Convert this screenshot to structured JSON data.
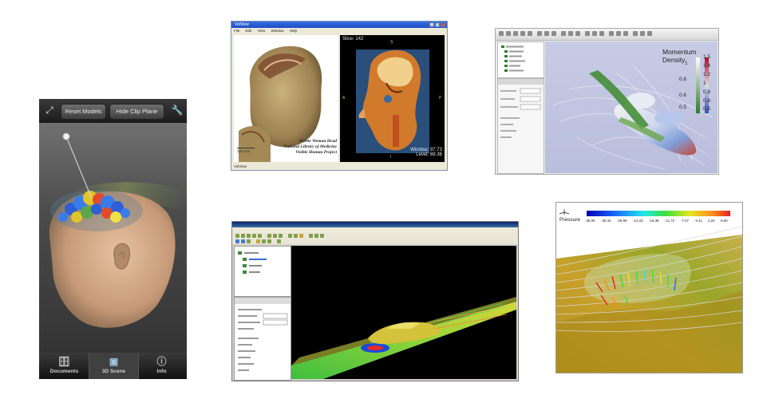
{
  "mobile_app": {
    "toolbar": {
      "reset_label": "Reset Models",
      "clip_label": "Hide Clip Plane"
    },
    "tabs": [
      {
        "label": "Documents",
        "icon": "documents-icon"
      },
      {
        "label": "3D Scene",
        "icon": "scene-icon",
        "selected": true
      },
      {
        "label": "Info",
        "icon": "info-icon"
      }
    ]
  },
  "volume_viewer": {
    "titlebar_text": "VolView",
    "menu": [
      "File",
      "Edit",
      "View",
      "Window",
      "Help"
    ],
    "slice_label": "Slice: 142",
    "orientation": {
      "top": "S",
      "left": "A",
      "right": "P",
      "bottom": "I"
    },
    "caption_lines": [
      "Visible Woman Head",
      "National Library of Medicine",
      "Visible Human Project"
    ],
    "scale_label": "100 mm",
    "window_label": "Window: 97.73",
    "level_label": "Level: 69.36",
    "status_text": "VolView"
  },
  "momentum_viewer": {
    "colorbar_title": "Momentum Density",
    "left_bar_ticks": [
      "1",
      "0.8",
      "0.6",
      "0.5"
    ],
    "right_bar_ticks": [
      "1.5",
      "1.4",
      "1.2",
      "1",
      "0.8",
      "0.6",
      "0.5"
    ]
  },
  "pressure_viewer": {
    "colorbar_label": "Pressure",
    "ticks": [
      "-35.00",
      "-30.34",
      "-25.69",
      "-21.03",
      "-16.38",
      "-11.72",
      "-7.07",
      "-2.41",
      "2.24",
      "6.90"
    ]
  }
}
